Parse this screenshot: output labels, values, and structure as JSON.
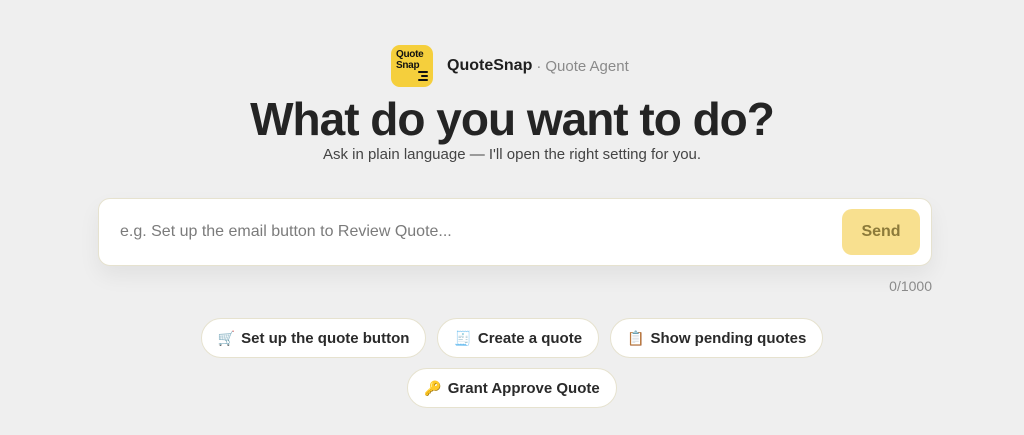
{
  "brand": {
    "logo_text_line1": "Quote",
    "logo_text_line2": "Snap",
    "name": "QuoteSnap",
    "separator": "·",
    "subtitle": "Quote Agent",
    "accent_color": "#f5cf3c"
  },
  "hero": {
    "title": "What do you want to do?",
    "subtitle": "Ask in plain language — I'll open the right setting for you."
  },
  "prompt": {
    "placeholder": "e.g. Set up the email button to Review Quote...",
    "value": "",
    "send_label": "Send",
    "counter": "0/1000"
  },
  "suggestions": [
    {
      "icon": "🛒",
      "icon_name": "cart-icon",
      "label": "Set up the quote button"
    },
    {
      "icon": "🧾",
      "icon_name": "receipt-icon",
      "label": "Create a quote"
    },
    {
      "icon": "📋",
      "icon_name": "clipboard-icon",
      "label": "Show pending quotes"
    },
    {
      "icon": "🔑",
      "icon_name": "key-icon",
      "label": "Grant Approve Quote"
    }
  ]
}
